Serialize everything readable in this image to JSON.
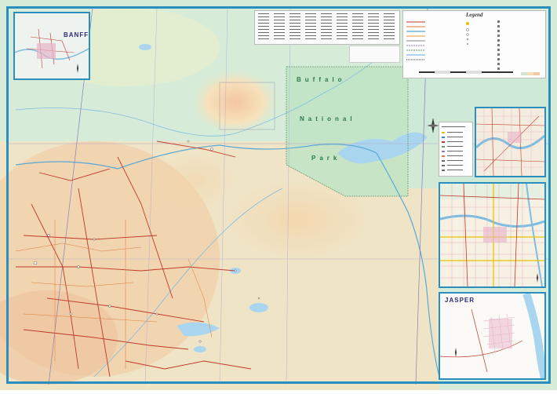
{
  "map": {
    "colors": {
      "lowland": "#cfe6d4",
      "upland": "#f6dfb8",
      "highland": "#f1c9a2",
      "water": "#a9d6ee",
      "frame": "#2a8fbf",
      "road": "#c0392b",
      "park": "#bfe3c6"
    },
    "labels": {
      "park_word1": "Buffalo",
      "park_word2": "National",
      "park_word3": "Park"
    },
    "insets": {
      "banff": {
        "title": "BANFF"
      },
      "jasper": {
        "title": "JASPER"
      }
    },
    "legend": {
      "title": "Legend"
    }
  }
}
